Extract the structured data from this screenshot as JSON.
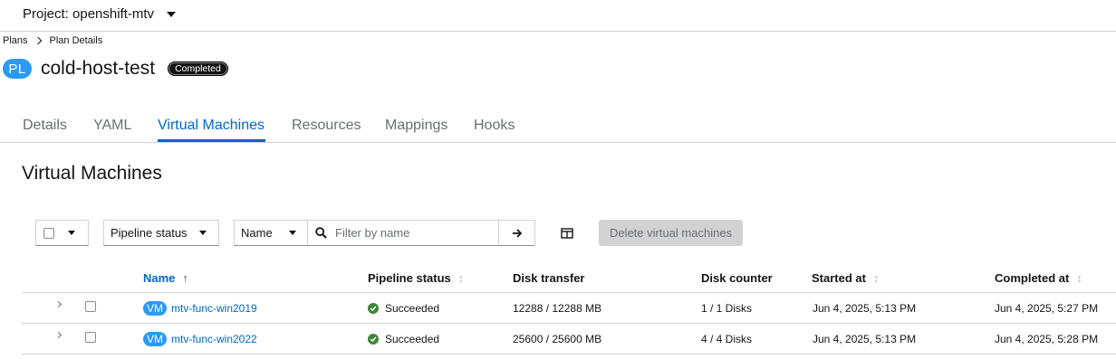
{
  "project": {
    "label": "Project: openshift-mtv"
  },
  "breadcrumb": {
    "items": [
      "Plans",
      "Plan Details"
    ]
  },
  "title": {
    "badge": "PL",
    "name": "cold-host-test",
    "status": "Completed"
  },
  "tabs": [
    "Details",
    "YAML",
    "Virtual Machines",
    "Resources",
    "Mappings",
    "Hooks"
  ],
  "active_tab": "Virtual Machines",
  "section": {
    "title": "Virtual Machines"
  },
  "toolbar": {
    "status_filter": "Pipeline status",
    "name_filter": "Name",
    "search_placeholder": "Filter by name",
    "delete_label": "Delete virtual machines"
  },
  "table": {
    "columns": [
      "Name",
      "Pipeline status",
      "Disk transfer",
      "Disk counter",
      "Started at",
      "Completed at"
    ],
    "sorted_column": "Name",
    "rows": [
      {
        "badge": "VM",
        "name": "mtv-func-win2019",
        "status": "Succeeded",
        "disk_transfer": "12288 / 12288 MB",
        "disk_counter": "1 / 1 Disks",
        "started": "Jun 4, 2025, 5:13 PM",
        "completed": "Jun 4, 2025, 5:27 PM"
      },
      {
        "badge": "VM",
        "name": "mtv-func-win2022",
        "status": "Succeeded",
        "disk_transfer": "25600 / 25600 MB",
        "disk_counter": "4 / 4 Disks",
        "started": "Jun 4, 2025, 5:13 PM",
        "completed": "Jun 4, 2025, 5:28 PM"
      }
    ]
  },
  "colors": {
    "link": "#0066cc",
    "badge": "#2b9af3",
    "success": "#3e8635",
    "border": "#d2d2d2"
  },
  "icons": [
    "caret-down-icon",
    "chevron-right-icon",
    "search-icon",
    "arrow-right-icon",
    "columns-icon",
    "sort-asc-icon",
    "sort-icon",
    "check-circle-icon"
  ]
}
